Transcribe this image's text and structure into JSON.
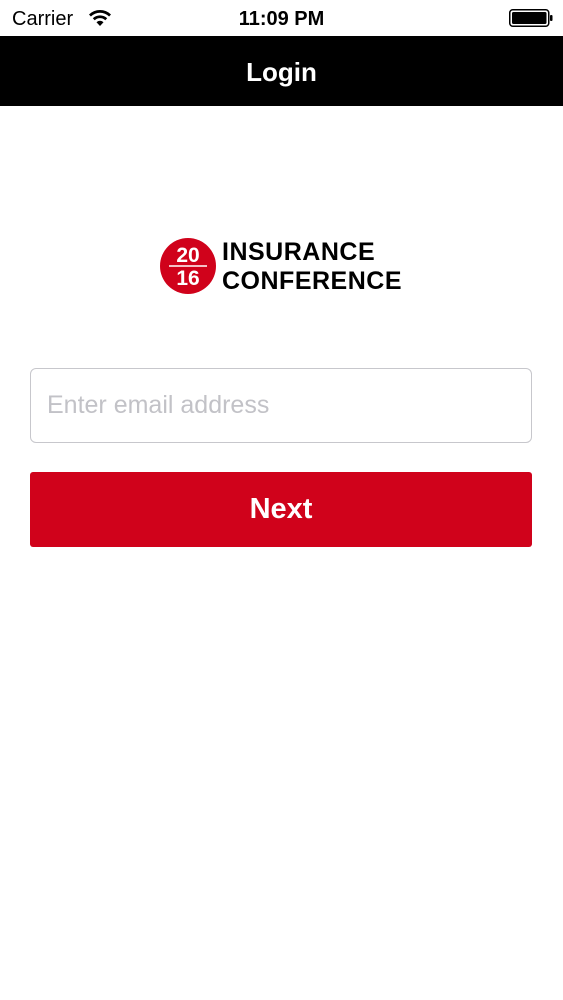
{
  "status_bar": {
    "carrier": "Carrier",
    "time": "11:09 PM",
    "wifi_icon": "wifi-icon",
    "battery_icon": "battery-full-icon"
  },
  "nav": {
    "title": "Login",
    "background": "#000000"
  },
  "logo": {
    "badge_top": "20",
    "badge_bottom": "16",
    "line1": "INSURANCE",
    "line2": "CONFERENCE",
    "brand_color": "#d0021b"
  },
  "form": {
    "email_placeholder": "Enter email address",
    "email_value": "",
    "next_label": "Next",
    "accent_color": "#d0021b"
  }
}
